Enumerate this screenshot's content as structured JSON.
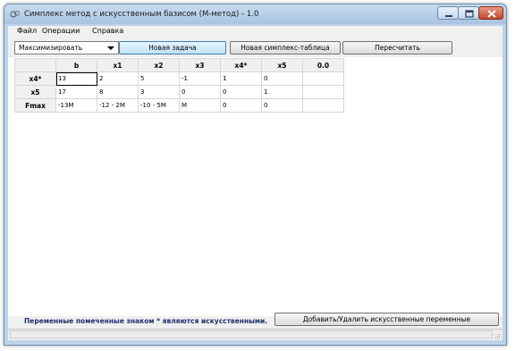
{
  "window": {
    "title": "Симплекс метод с искусственным базисом (M-метод) - 1.0",
    "icon": "app-icon"
  },
  "menu": {
    "items": [
      "Файл",
      "Операции",
      "Справка"
    ]
  },
  "toolbar": {
    "mode_select_value": "Максимизировать",
    "new_task_label": "Новая задача",
    "new_basis_label": "Новая симплекс-таблица",
    "recalc_label": "Пересчитать"
  },
  "table": {
    "columns": [
      "b",
      "x1",
      "x2",
      "x3",
      "x4*",
      "x5",
      "0.0"
    ],
    "rows": [
      {
        "label": "x4*",
        "cells": [
          "13",
          "2",
          "5",
          "-1",
          "1",
          "0",
          ""
        ]
      },
      {
        "label": "x5",
        "cells": [
          "17",
          "8",
          "3",
          "0",
          "0",
          "1",
          ""
        ]
      },
      {
        "label": "Fmax",
        "cells": [
          "-13M",
          "-12 - 2M",
          "-10 - 5M",
          "M",
          "0",
          "0",
          ""
        ]
      }
    ]
  },
  "footer": {
    "note": "Переменные помеченные знаком * являются искусственными.",
    "toggle_button_label": "Добавить/Удалить искусственные переменные"
  },
  "colors": {
    "title_bar": "#bcd3ea",
    "close_button": "#c4452a",
    "active_button": "#bfe3f7",
    "note_text": "#1f2f6b"
  }
}
